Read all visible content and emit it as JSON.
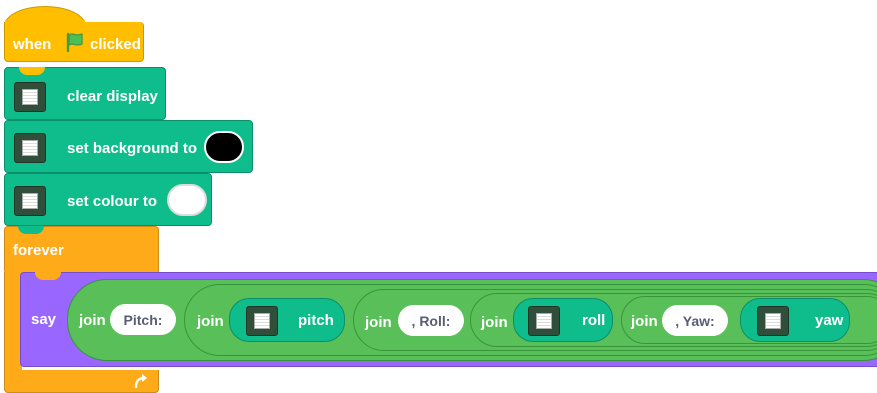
{
  "hat": {
    "label_when": "when",
    "label_clicked": "clicked",
    "flag_icon": "green-flag-icon"
  },
  "blocks": {
    "clear": {
      "label": "clear display"
    },
    "background": {
      "label": "set background to",
      "color": "#000000"
    },
    "colour": {
      "label": "set colour to",
      "color": "#ffffff"
    }
  },
  "forever": {
    "label": "forever",
    "loop_icon": "loop-arrow-icon"
  },
  "say": {
    "label": "say",
    "join1": {
      "label": "join",
      "text": "Pitch:"
    },
    "join2": {
      "label": "join",
      "reporter": "pitch"
    },
    "join3": {
      "label": "join",
      "text": ", Roll:"
    },
    "join4": {
      "label": "join",
      "reporter": "roll"
    },
    "join5": {
      "label": "join",
      "text": ", Yaw:"
    },
    "reporter_last": "yaw"
  },
  "colors": {
    "events": "#ffbf00",
    "extension": "#0fbd8c",
    "control": "#ffab19",
    "looks": "#9966ff",
    "operators": "#59c059"
  }
}
